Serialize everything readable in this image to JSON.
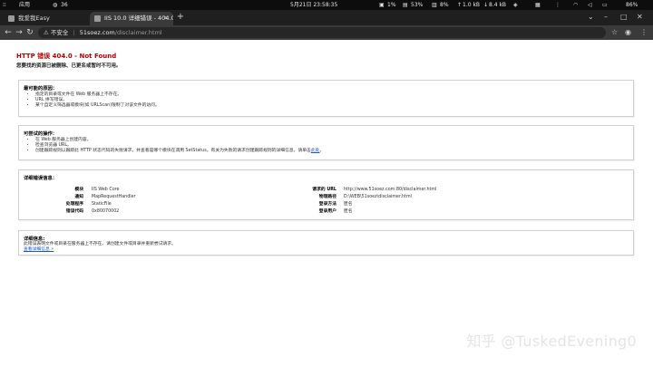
{
  "os_bar": {
    "left_label": "应用",
    "left_icon": "app-grid-icon",
    "count": "36",
    "datetime": "5月21日  23:58:35",
    "cpu": "1%",
    "mem": "53%",
    "disk": "8%",
    "net_up": "1.0 kB",
    "net_down": "8.4 kB",
    "battery": "86%"
  },
  "tabs": [
    {
      "label": "我爱我Easy",
      "active": false,
      "favicon": "page-icon"
    },
    {
      "label": "IIS 10.0 详细错误 - 404.0",
      "active": true,
      "favicon": "page-icon"
    }
  ],
  "toolbar": {
    "security_label": "不安全",
    "url_host": "51soez.com",
    "url_path": "/disclaimer.html"
  },
  "page": {
    "error_title": "HTTP 错误 404.0 - Not Found",
    "error_subtitle": "您要找的资源已被删除、已更名或暂时不可用。",
    "causes": {
      "heading": "最可能的原因：",
      "items": [
        "指定的目录或文件在 Web 服务器上不存在。",
        "URL 拼写错误。",
        "某个自定义筛选器或模块(如 URLScan)限制了对该文件的访问。"
      ]
    },
    "actions": {
      "heading": "可尝试的操作：",
      "items": [
        "在 Web 服务器上创建内容。",
        "检查浏览器 URL。",
        "创建跟踪规则以跟踪此 HTTP 状态代码的失败请求，并查看是哪个模块在调用 SetStatus。有关为失败的请求创建跟踪规则的详细信息，请单击"
      ],
      "link_label": "此处",
      "link_tail": "。"
    },
    "error_info": {
      "heading": "详细错误信息：",
      "left": [
        {
          "k": "模块",
          "v": "IIS Web Core"
        },
        {
          "k": "通知",
          "v": "MapRequestHandler"
        },
        {
          "k": "处理程序",
          "v": "StaticFile"
        },
        {
          "k": "错误代码",
          "v": "0x80070002"
        }
      ],
      "right": [
        {
          "k": "请求的 URL",
          "v": "http://www.51soez.com:80/disclaimer.html"
        },
        {
          "k": "物理路径",
          "v": "D:\\WEB\\51soez\\disclaimer.html"
        },
        {
          "k": "登录方法",
          "v": "匿名"
        },
        {
          "k": "登录用户",
          "v": "匿名"
        }
      ]
    },
    "more_info": {
      "heading": "详细信息:",
      "text": "此错误表明文件或目录在服务器上不存在。请创建文件或目录并重新尝试请求。",
      "link_label": "查看详细信息 »"
    }
  },
  "watermark": "知乎 @TuskedEvening0"
}
